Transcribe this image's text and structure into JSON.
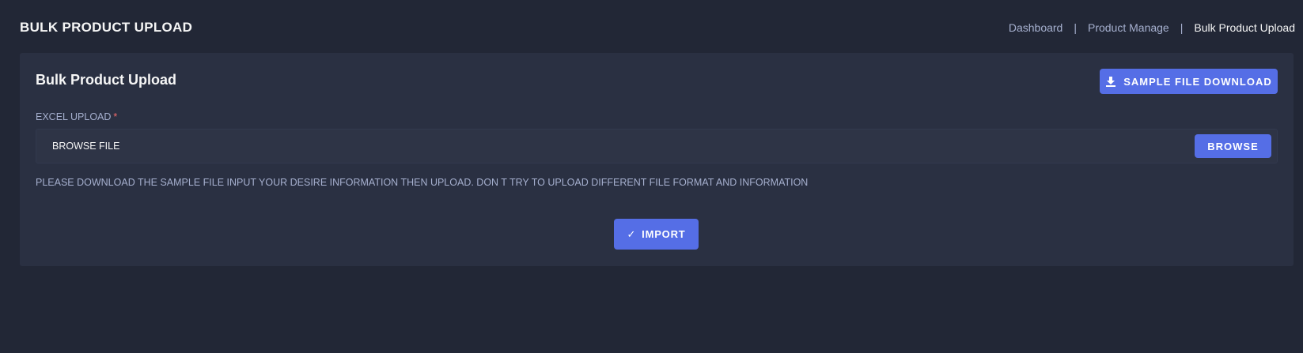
{
  "header": {
    "title": "BULK PRODUCT UPLOAD",
    "breadcrumb": [
      {
        "label": "Dashboard"
      },
      {
        "label": "Product Manage"
      },
      {
        "label": "Bulk Product Upload"
      }
    ],
    "separator": "|"
  },
  "card": {
    "title": "Bulk Product Upload",
    "sample_button": {
      "label": "SAMPLE FILE DOWNLOAD",
      "icon": "download-icon"
    },
    "excel_upload": {
      "label": "EXCEL UPLOAD",
      "required_mark": "*",
      "value": "BROWSE FILE",
      "browse_label": "BROWSE"
    },
    "help_text": "PLEASE DOWNLOAD THE SAMPLE FILE INPUT YOUR DESIRE INFORMATION THEN UPLOAD. DON T TRY TO UPLOAD DIFFERENT FILE FORMAT AND INFORMATION",
    "import_button": {
      "label": "IMPORT",
      "icon": "check-icon",
      "glyph": "✓"
    }
  },
  "colors": {
    "background": "#222736",
    "card": "#2a3042",
    "primary": "#556ee6",
    "required": "#f46a6a"
  }
}
